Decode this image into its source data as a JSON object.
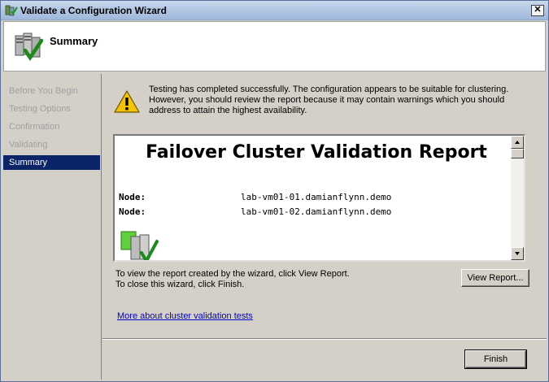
{
  "window": {
    "title": "Validate a Configuration Wizard",
    "close_label": "✕"
  },
  "header": {
    "title": "Summary"
  },
  "sidebar": {
    "items": [
      {
        "label": "Before You Begin",
        "state": "inactive"
      },
      {
        "label": "Testing Options",
        "state": "inactive"
      },
      {
        "label": "Confirmation",
        "state": "inactive"
      },
      {
        "label": "Validating",
        "state": "inactive"
      },
      {
        "label": "Summary",
        "state": "active"
      }
    ]
  },
  "main": {
    "warning_text": "Testing has completed successfully. The configuration appears to be suitable for clustering. However, you should review the report because it may contain warnings which you should address to attain the highest availability.",
    "report": {
      "title": "Failover Cluster Validation Report",
      "nodes": [
        {
          "label": "Node:",
          "value": "lab-vm01-01.damianflynn.demo"
        },
        {
          "label": "Node:",
          "value": "lab-vm01-02.damianflynn.demo"
        }
      ]
    },
    "hint_line1": "To view the report created by the wizard, click View Report.",
    "hint_line2": "To close this wizard, click Finish.",
    "view_report_label": "View Report...",
    "more_link": "More about cluster validation tests",
    "finish_label": "Finish"
  },
  "colors": {
    "selection": "#0a246a",
    "link": "#0000cc",
    "disabled_text": "#a0a0a0"
  }
}
